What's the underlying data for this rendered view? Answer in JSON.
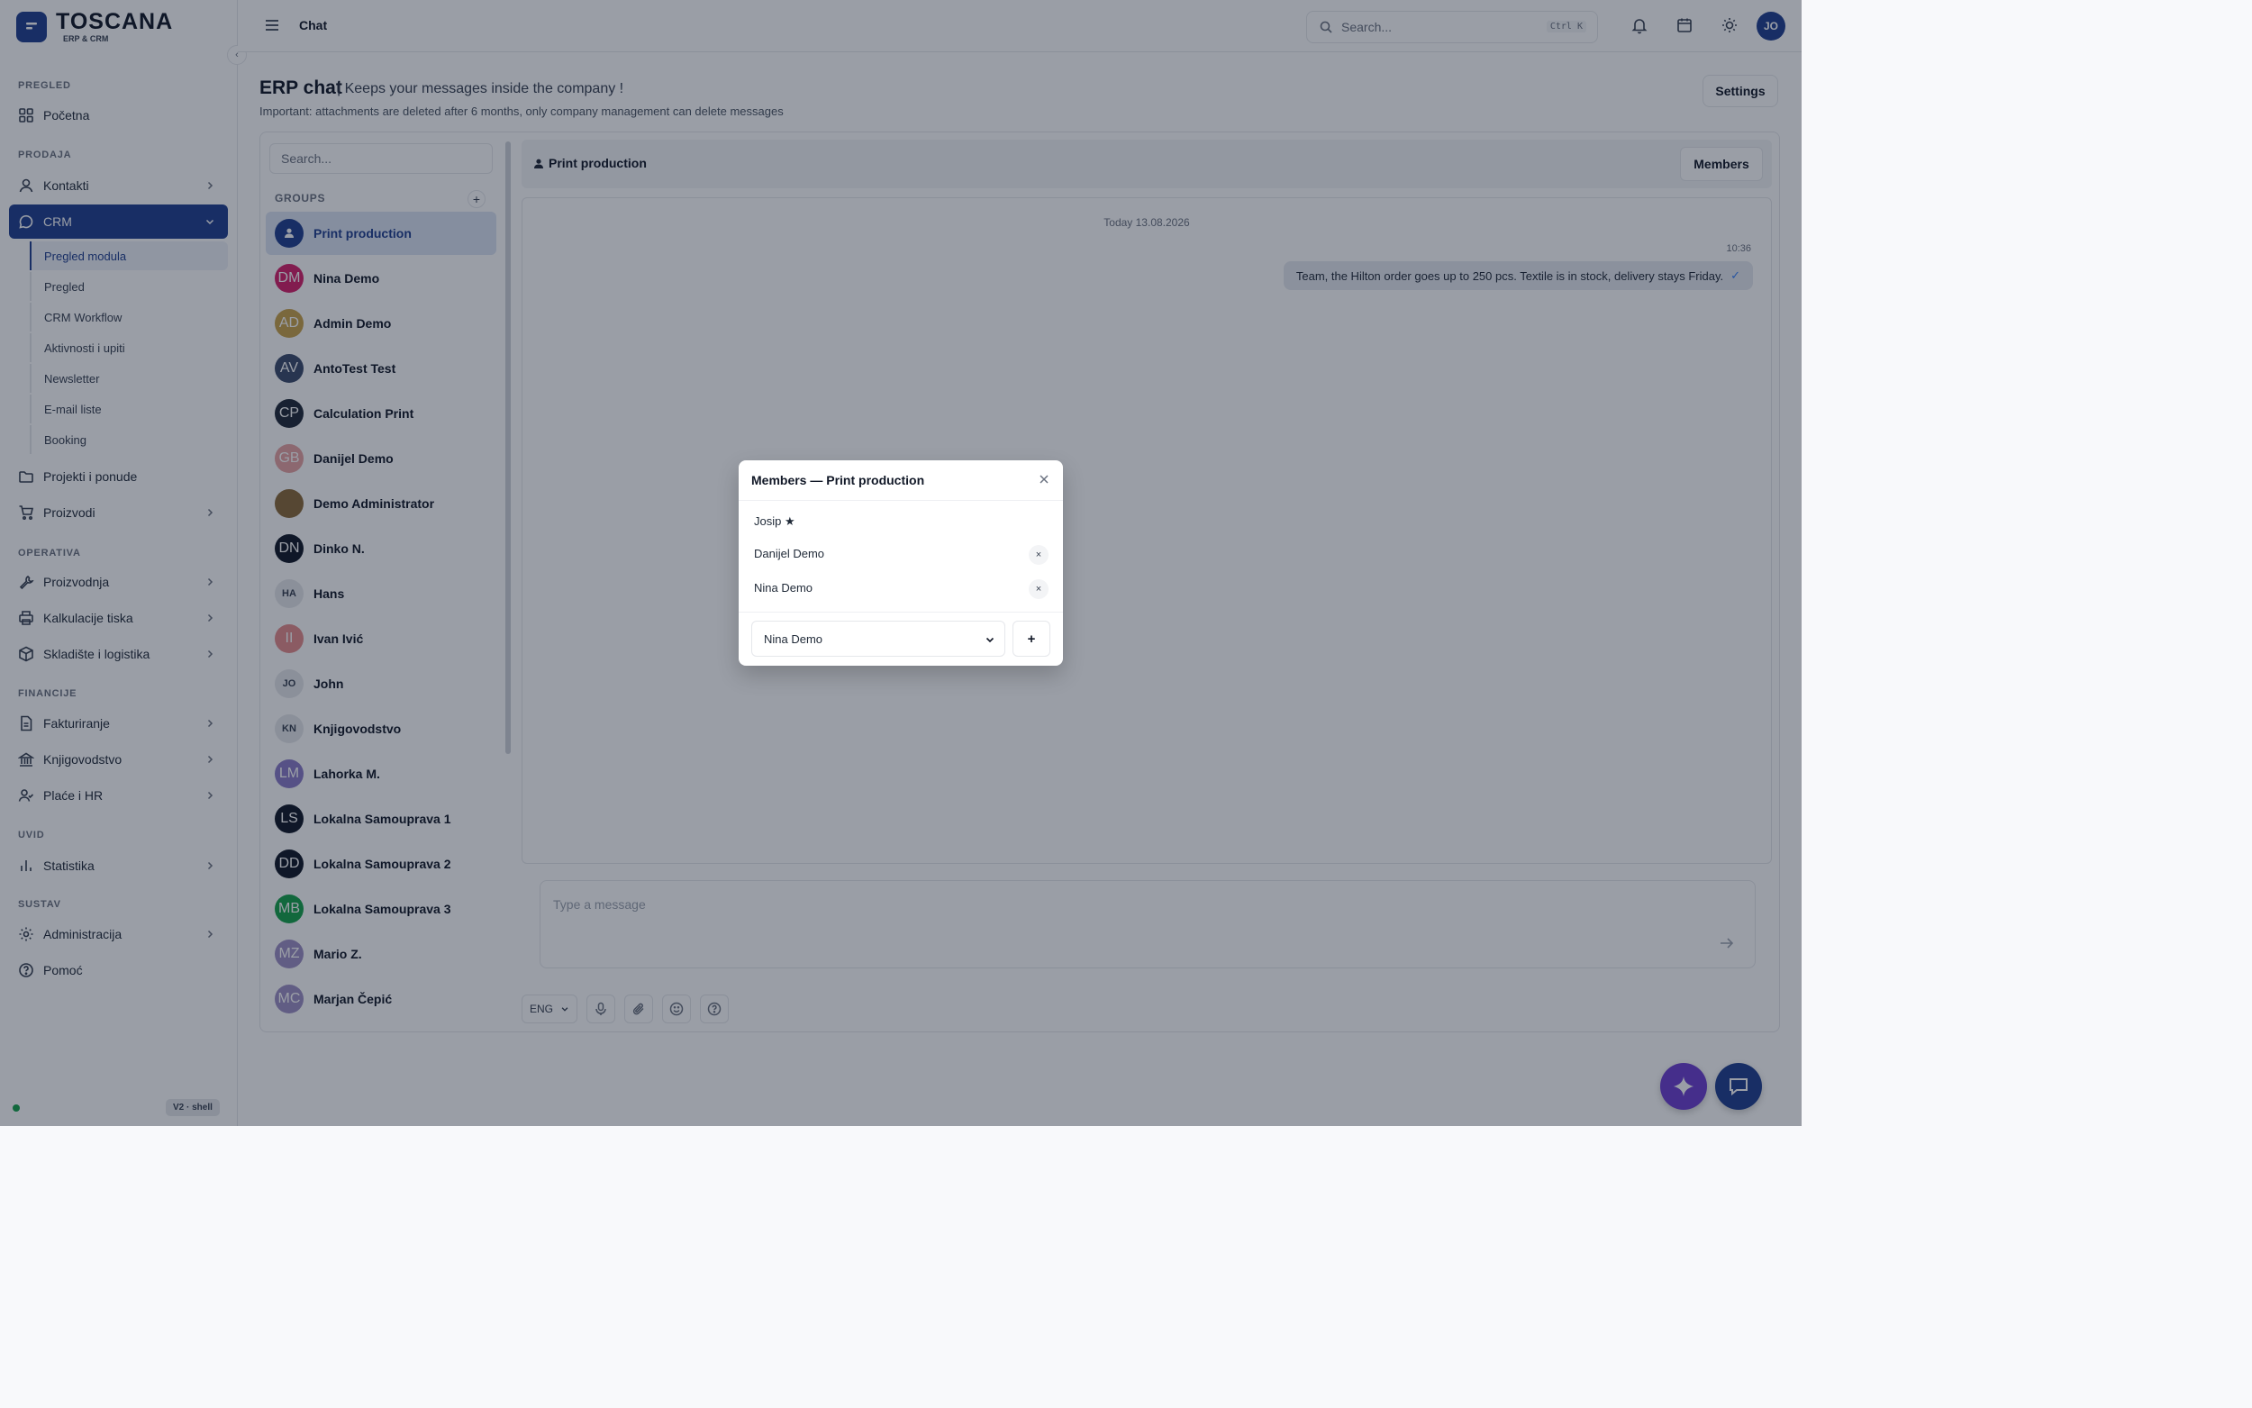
{
  "brand": {
    "title": "TOSCANA",
    "subtitle": "ERP & CRM"
  },
  "sidebar": {
    "sections": [
      "PREGLED",
      "PRODAJA",
      "OPERATIVA",
      "FINANCIJE",
      "UVID",
      "SUSTAV"
    ],
    "items": [
      {
        "label": "Početna",
        "icon": "grid-icon"
      },
      {
        "label": "Kontakti",
        "icon": "user-icon"
      },
      {
        "label": "CRM",
        "icon": "message-circle-icon"
      },
      {
        "label": "Projekti i ponude",
        "icon": "folder-icon"
      },
      {
        "label": "Proizvodi",
        "icon": "cart-icon"
      },
      {
        "label": "Proizvodnja",
        "icon": "wrench-icon"
      },
      {
        "label": "Kalkulacije tiska",
        "icon": "printer-icon"
      },
      {
        "label": "Skladište i logistika",
        "icon": "box-icon"
      },
      {
        "label": "Fakturiranje",
        "icon": "file-icon"
      },
      {
        "label": "Knjigovodstvo",
        "icon": "bank-icon"
      },
      {
        "label": "Plaće i HR",
        "icon": "users-icon"
      },
      {
        "label": "Statistika",
        "icon": "bar-chart-icon"
      },
      {
        "label": "Administracija",
        "icon": "gear-icon"
      },
      {
        "label": "Pomoć",
        "icon": "help-icon"
      }
    ],
    "crm_sub": [
      "Pregled modula",
      "Pregled",
      "CRM Workflow",
      "Aktivnosti i upiti",
      "Newsletter",
      "E-mail liste",
      "Booking"
    ],
    "version": "V2 · shell"
  },
  "topbar": {
    "title": "Chat",
    "search_placeholder": "Search...",
    "shortcut": "Ctrl K",
    "user_initials": "JO"
  },
  "page": {
    "title": "ERP chat",
    "tagline": "| Keeps your messages inside the company !",
    "note": "Important: attachments are deleted after 6 months, only company management can delete messages",
    "settings_label": "Settings"
  },
  "conversations": {
    "search_placeholder": "Search...",
    "groups_label": "GROUPS",
    "add_label": "+",
    "items": [
      {
        "name": "Print production",
        "initials": "",
        "color": "#1f3f8f"
      },
      {
        "name": "Nina Demo",
        "initials": "DM",
        "color": "#d61f69"
      },
      {
        "name": "Admin Demo",
        "initials": "AD",
        "color": "#c9a24b"
      },
      {
        "name": "AntoTest Test",
        "initials": "AV",
        "color": "#3b4a6b"
      },
      {
        "name": "Calculation Print",
        "initials": "CP",
        "color": "#1f2937"
      },
      {
        "name": "Danijel Demo",
        "initials": "GB",
        "color": "#e7a2a2"
      },
      {
        "name": "Demo Administrator",
        "initials": "",
        "color": "#8a6a3a"
      },
      {
        "name": "Dinko N.",
        "initials": "DN",
        "color": "#111827"
      },
      {
        "name": "Hans",
        "initials": "HA",
        "color": ""
      },
      {
        "name": "Ivan Ivić",
        "initials": "II",
        "color": "#e58c8c"
      },
      {
        "name": "John",
        "initials": "JO",
        "color": ""
      },
      {
        "name": "Knjigovodstvo",
        "initials": "KN",
        "color": ""
      },
      {
        "name": "Lahorka M.",
        "initials": "LM",
        "color": "#8a7bc8"
      },
      {
        "name": "Lokalna Samouprava 1",
        "initials": "LS",
        "color": "#111827"
      },
      {
        "name": "Lokalna Samouprava 2",
        "initials": "DD",
        "color": "#111827"
      },
      {
        "name": "Lokalna Samouprava 3",
        "initials": "MB",
        "color": "#16a34a"
      },
      {
        "name": "Mario Z.",
        "initials": "MZ",
        "color": "#9d8fc4"
      },
      {
        "name": "Marjan Čepić",
        "initials": "MC",
        "color": "#9d8fc4"
      }
    ]
  },
  "chat": {
    "name": "Print production",
    "members_label": "Members",
    "day_label": "Today 13.08.2026",
    "message": {
      "time": "10:36",
      "text": "Team, the Hilton order goes up to 250 pcs. Textile is in stock, delivery stays Friday.",
      "status": "✓"
    },
    "compose_placeholder": "Type a message",
    "lang": "ENG"
  },
  "modal": {
    "title": "Members — Print production",
    "owner": "Josip ★",
    "members": [
      "Danijel Demo",
      "Nina Demo"
    ],
    "remove_symbol": "×",
    "select_value": "Nina Demo",
    "add_symbol": "+"
  }
}
